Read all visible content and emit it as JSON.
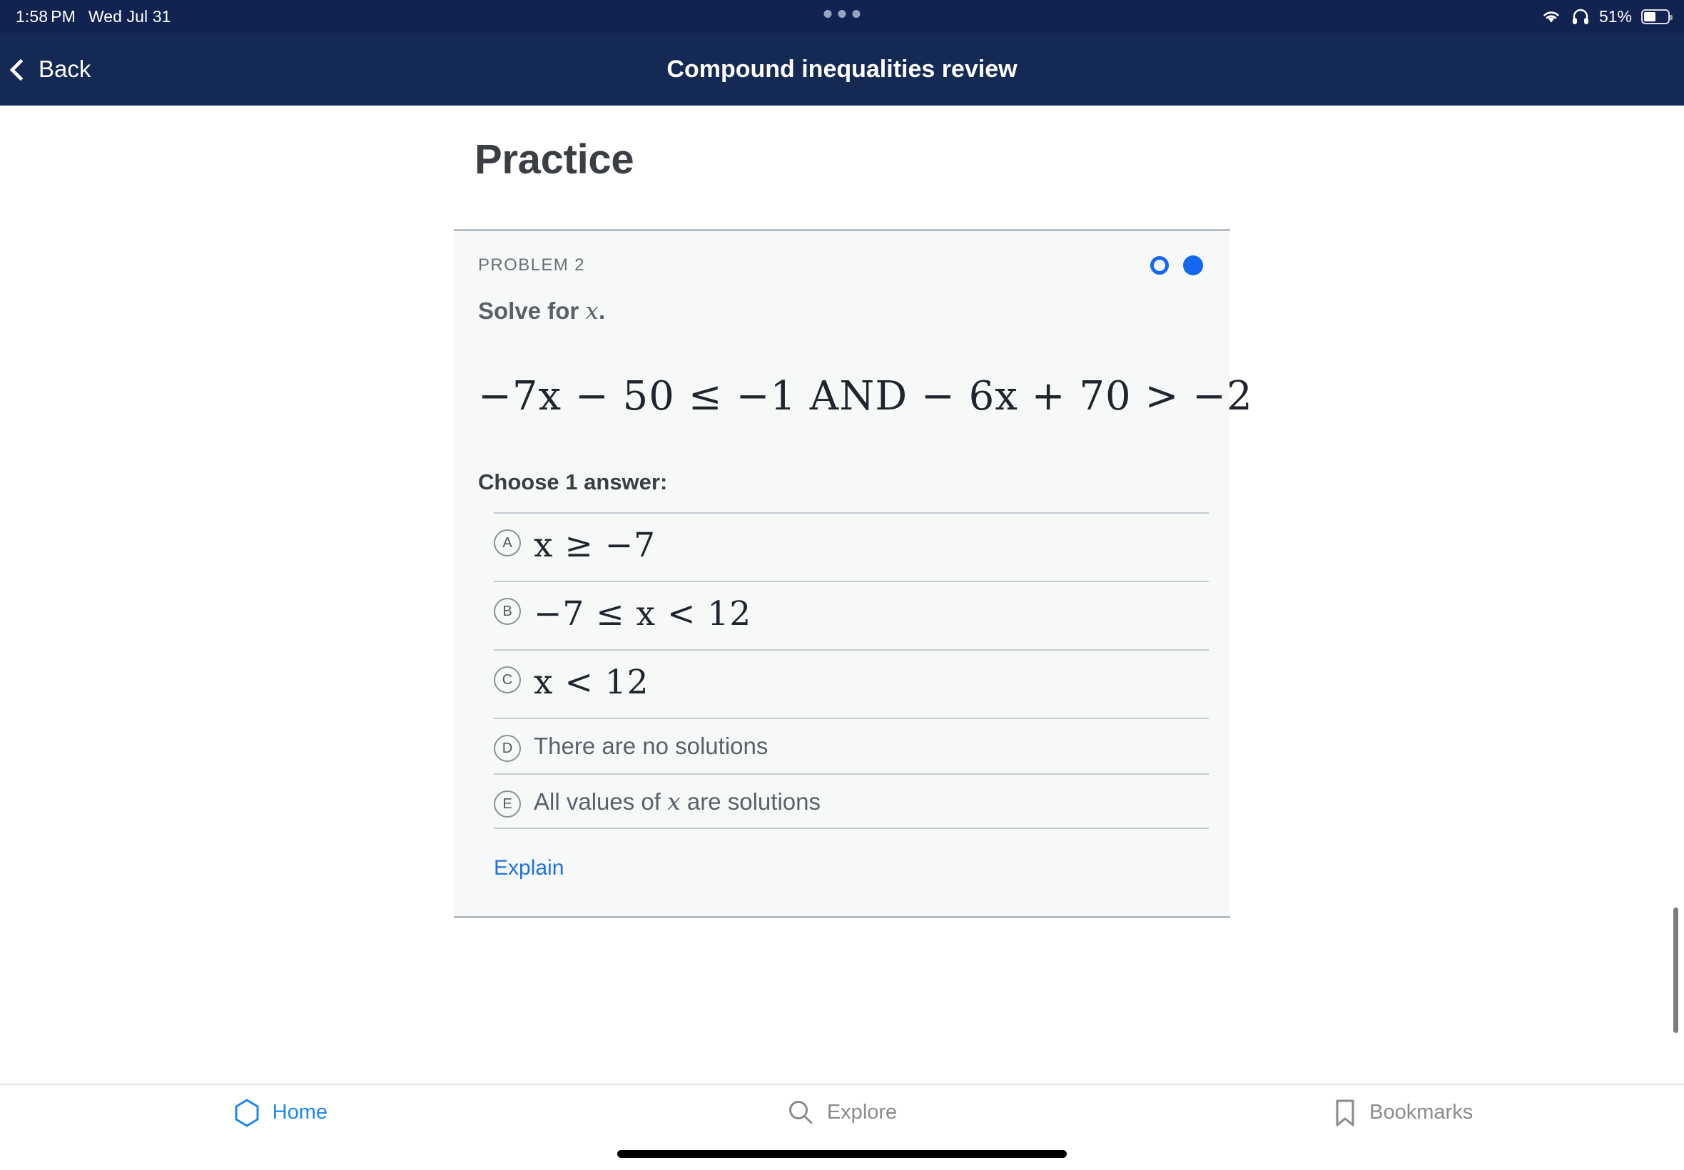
{
  "statusbar": {
    "time": "1:58",
    "ampm": "PM",
    "date": "Wed Jul 31",
    "battery_percent": "51%",
    "wifi_icon": "wifi-icon",
    "headphones_icon": "headphones-icon",
    "battery_icon": "battery-icon",
    "dots_icon": "three-dots-icon"
  },
  "navbar": {
    "back_label": "Back",
    "title": "Compound inequalities review",
    "back_icon": "chevron-left-icon"
  },
  "main": {
    "page_title": "Practice",
    "problem_label": "PROBLEM 2",
    "prompt_prefix": "Solve for ",
    "prompt_var": "x",
    "prompt_suffix": ".",
    "equation": "−7x − 50 ≤ −1  AND  − 6x + 70 > −2",
    "choose_label": "Choose 1 answer:",
    "explain_label": "Explain",
    "progress_dots": [
      {
        "name": "problem-dot-1",
        "state": "hollow"
      },
      {
        "name": "problem-dot-2",
        "state": "filled"
      }
    ],
    "options": [
      {
        "letter": "A",
        "kind": "math",
        "text": "x ≥ −7"
      },
      {
        "letter": "B",
        "kind": "math",
        "text": "−7 ≤ x < 12"
      },
      {
        "letter": "C",
        "kind": "math",
        "text": "x < 12"
      },
      {
        "letter": "D",
        "kind": "text",
        "text": "There are no solutions"
      },
      {
        "letter": "E",
        "kind": "text",
        "text": "All values of x are solutions"
      }
    ]
  },
  "tabbar": {
    "tabs": [
      {
        "label": "Home",
        "icon": "hexagon-icon",
        "active": true
      },
      {
        "label": "Explore",
        "icon": "search-icon",
        "active": false
      },
      {
        "label": "Bookmarks",
        "icon": "bookmark-icon",
        "active": false
      }
    ]
  },
  "colors": {
    "navy": "#142953",
    "accent_blue": "#1667f0",
    "link_blue": "#1f6fe5",
    "card_bg": "#f7f8f8",
    "muted": "#6b6f76"
  }
}
